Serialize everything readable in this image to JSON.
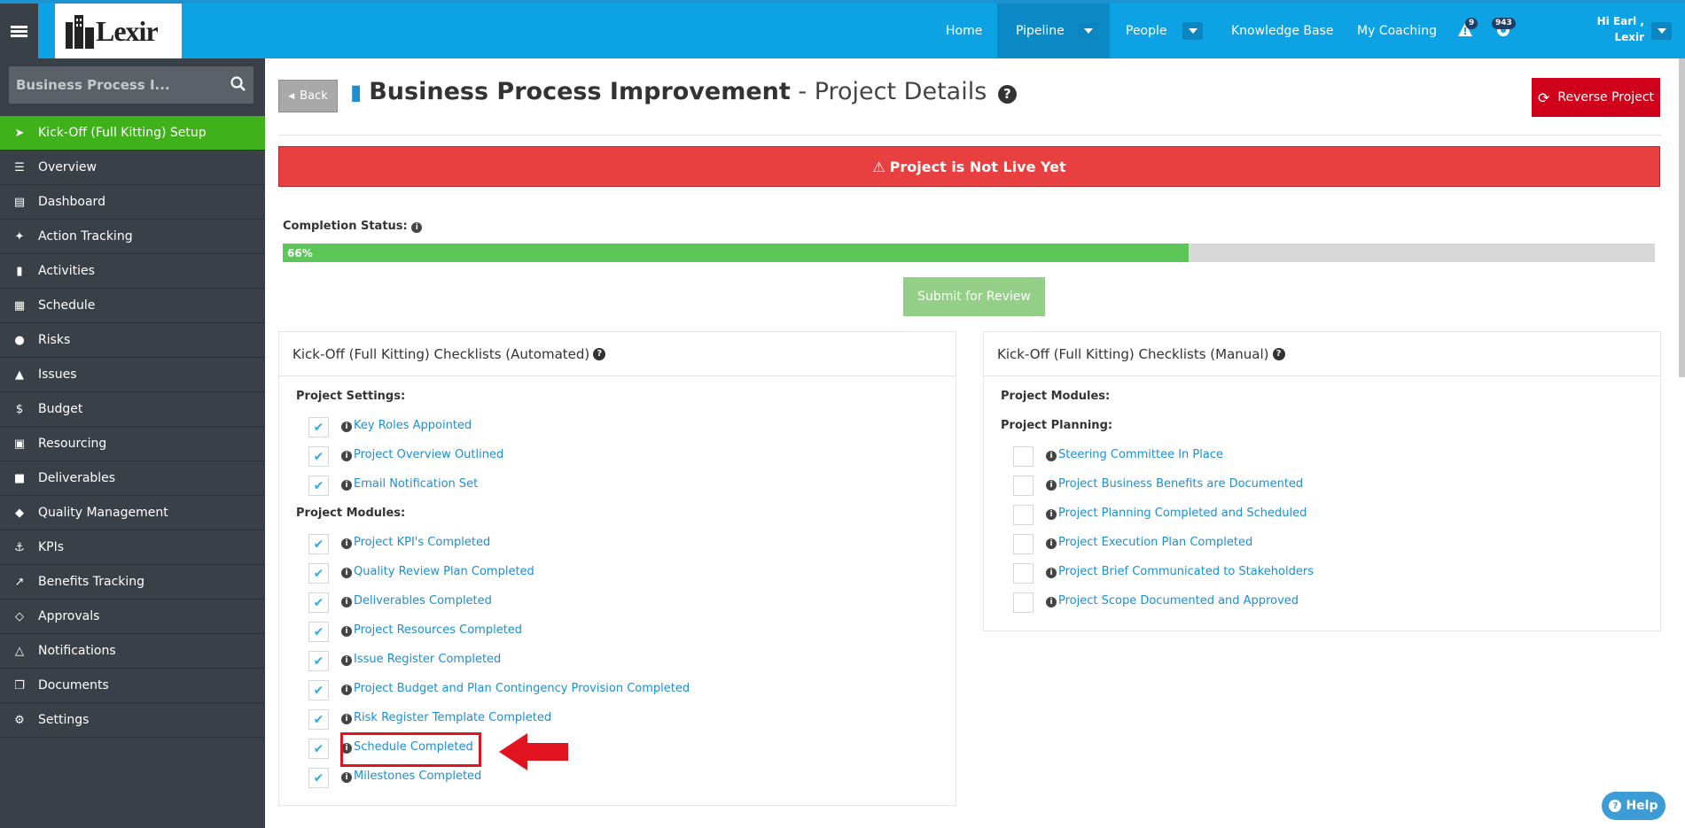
{
  "topbar": {
    "logo_text": "Lexir",
    "nav": [
      {
        "label": "Home"
      },
      {
        "label": "Pipeline"
      },
      {
        "label": "People"
      },
      {
        "label": "Knowledge Base"
      },
      {
        "label": "My Coaching"
      }
    ],
    "alerts_count": "9",
    "notifications_count": "943",
    "greeting": "Hi Earl ,",
    "user_name": "Lexir"
  },
  "sidebar": {
    "search_value": "Business Process I...",
    "items": [
      {
        "label": "Kick-Off (Full Kitting) Setup",
        "icon": "rocket-icon",
        "active": true
      },
      {
        "label": "Overview",
        "icon": "list-icon"
      },
      {
        "label": "Dashboard",
        "icon": "dashboard-icon"
      },
      {
        "label": "Action Tracking",
        "icon": "crosshairs-icon"
      },
      {
        "label": "Activities",
        "icon": "bookmark-icon"
      },
      {
        "label": "Schedule",
        "icon": "calendar-icon"
      },
      {
        "label": "Risks",
        "icon": "lightbulb-icon"
      },
      {
        "label": "Issues",
        "icon": "warning-icon"
      },
      {
        "label": "Budget",
        "icon": "dollar-icon"
      },
      {
        "label": "Resourcing",
        "icon": "folder-icon"
      },
      {
        "label": "Deliverables",
        "icon": "truck-icon"
      },
      {
        "label": "Quality Management",
        "icon": "tag-icon"
      },
      {
        "label": "KPIs",
        "icon": "anchor-icon"
      },
      {
        "label": "Benefits Tracking",
        "icon": "line-chart-icon"
      },
      {
        "label": "Approvals",
        "icon": "ticket-icon"
      },
      {
        "label": "Notifications",
        "icon": "bell-icon"
      },
      {
        "label": "Documents",
        "icon": "copy-icon"
      },
      {
        "label": "Settings",
        "icon": "cogs-icon"
      }
    ]
  },
  "header": {
    "back_label": "Back",
    "title": "Business Process Improvement",
    "subtitle": "- Project Details",
    "reverse_label": "Reverse Project"
  },
  "alert": {
    "text": "Project is Not Live Yet"
  },
  "completion": {
    "label": "Completion Status:",
    "percent": 66,
    "percent_label": "66%"
  },
  "submit_label": "Submit for Review",
  "automated": {
    "title": "Kick-Off (Full Kitting) Checklists (Automated)",
    "settings_label": "Project Settings:",
    "settings_items": [
      "Key Roles Appointed",
      "Project Overview Outlined",
      "Email Notification Set"
    ],
    "modules_label": "Project Modules:",
    "modules_items": [
      "Project KPI's Completed",
      "Quality Review Plan Completed",
      "Deliverables Completed",
      "Project Resources Completed",
      "Issue Register Completed",
      "Project Budget and Plan Contingency Provision Completed",
      "Risk Register Template Completed",
      "Schedule Completed",
      "Milestones Completed"
    ]
  },
  "manual": {
    "title": "Kick-Off (Full Kitting) Checklists (Manual)",
    "modules_label": "Project Modules:",
    "planning_label": "Project Planning:",
    "planning_items": [
      "Steering Committee In Place",
      "Project Business Benefits are Documented",
      "Project Planning Completed and Scheduled",
      "Project Execution Plan Completed",
      "Project Brief Communicated to Stakeholders",
      "Project Scope Documented and Approved"
    ]
  },
  "help_label": "Help",
  "colors": {
    "topbar": "#0da2e4",
    "sidebar": "#3a4048",
    "active": "#3fb21b",
    "alert": "#e84040",
    "reverse": "#d0021b",
    "progress": "#5cc659"
  }
}
